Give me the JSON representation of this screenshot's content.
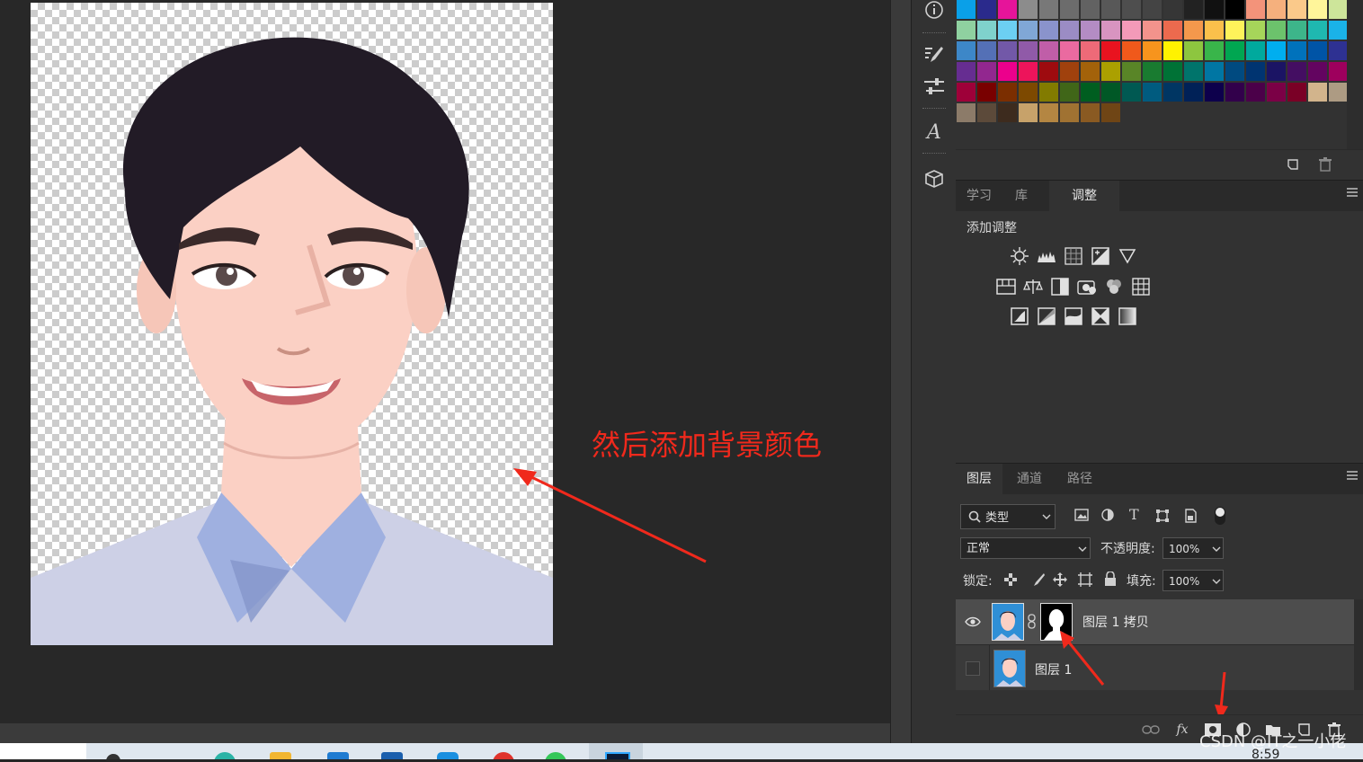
{
  "annotation": {
    "text": "然后添加背景颜色"
  },
  "panels": {
    "top_tabs": [
      "学习",
      "库",
      "调整"
    ],
    "active_top_tab": "调整",
    "adjust_title": "添加调整",
    "layer_tabs": [
      "图层",
      "通道",
      "路径"
    ],
    "active_layer_tab": "图层"
  },
  "layers_controls": {
    "filter_label": "类型",
    "blend_mode": "正常",
    "opacity_label": "不透明度:",
    "opacity_value": "100%",
    "lock_label": "锁定:",
    "fill_label": "填充:",
    "fill_value": "100%"
  },
  "layers": [
    {
      "name": "图层 1 拷贝",
      "visible": true,
      "has_mask": true,
      "selected": true
    },
    {
      "name": "图层 1",
      "visible": false,
      "has_mask": false,
      "selected": false
    }
  ],
  "footer_icons": [
    "link-icon",
    "fx-icon",
    "add-mask-icon",
    "adjustment-layer-icon",
    "group-icon",
    "new-layer-icon",
    "delete-icon"
  ],
  "layers_footer": {
    "fx": "fx"
  },
  "watermark": "CSDN @IT之一小佬",
  "clock": "8:59",
  "swatch_rows": [
    [
      "#0aa0e8",
      "#2a2a8c",
      "#e6149a",
      "#8c8c8c",
      "#787878",
      "#6c6c6c",
      "#626262",
      "#585858",
      "#4e4e4e",
      "#444444",
      "#363636",
      "#222222",
      "#111111",
      "#000000",
      "#f3937a",
      "#f5b07d",
      "#fac98a",
      "#fff59a",
      "#cde59a",
      "#9fd28e"
    ],
    [
      "#8fd1a0",
      "#7fd2cc",
      "#6ccff2",
      "#80a7d6",
      "#8a93cc",
      "#9b8cc4",
      "#b48cc4",
      "#d894c0",
      "#f39ab8",
      "#f3938c",
      "#ec6a4e",
      "#f4984c",
      "#fbc04b",
      "#fff35a",
      "#a6d55a",
      "#6cc26c",
      "#3db58a",
      "#1fb8b0",
      "#1ab2e8",
      "#3a86c8"
    ],
    [
      "#3d87c8",
      "#5470b6",
      "#7258a8",
      "#905aa8",
      "#c05ea8",
      "#ea6aa0",
      "#ee6a78",
      "#e9131f",
      "#f0591b",
      "#f7941d",
      "#fff200",
      "#8dc63f",
      "#39b54a",
      "#00a651",
      "#00a99d",
      "#00aeef",
      "#0072bc",
      "#0054a6",
      "#2e3192",
      "#662d91"
    ],
    [
      "#662d91",
      "#92278f",
      "#ec008c",
      "#ed145b",
      "#9e0b0f",
      "#a0410d",
      "#a3620a",
      "#aba000",
      "#598527",
      "#197b30",
      "#007236",
      "#00746b",
      "#0076a3",
      "#004a80",
      "#003471",
      "#1b1464",
      "#440e62",
      "#630460",
      "#9e005d",
      "#9e0039"
    ],
    [
      "#9e0039",
      "#790000",
      "#7b2e00",
      "#7d4900",
      "#827b00",
      "#406618",
      "#005e20",
      "#005826",
      "#005952",
      "#005b7f",
      "#003663",
      "#002157",
      "#0d004c",
      "#32004b",
      "#4b0049",
      "#7b0046",
      "#7a0026",
      "#d2b48c",
      "#ad9b83",
      "#bfa588"
    ],
    [
      "#8c7b69",
      "#5c4a3a",
      "#3d2b1e",
      "#c7a26a",
      "#b48642",
      "#a07232",
      "#8a5a22",
      "#6f4515"
    ]
  ]
}
